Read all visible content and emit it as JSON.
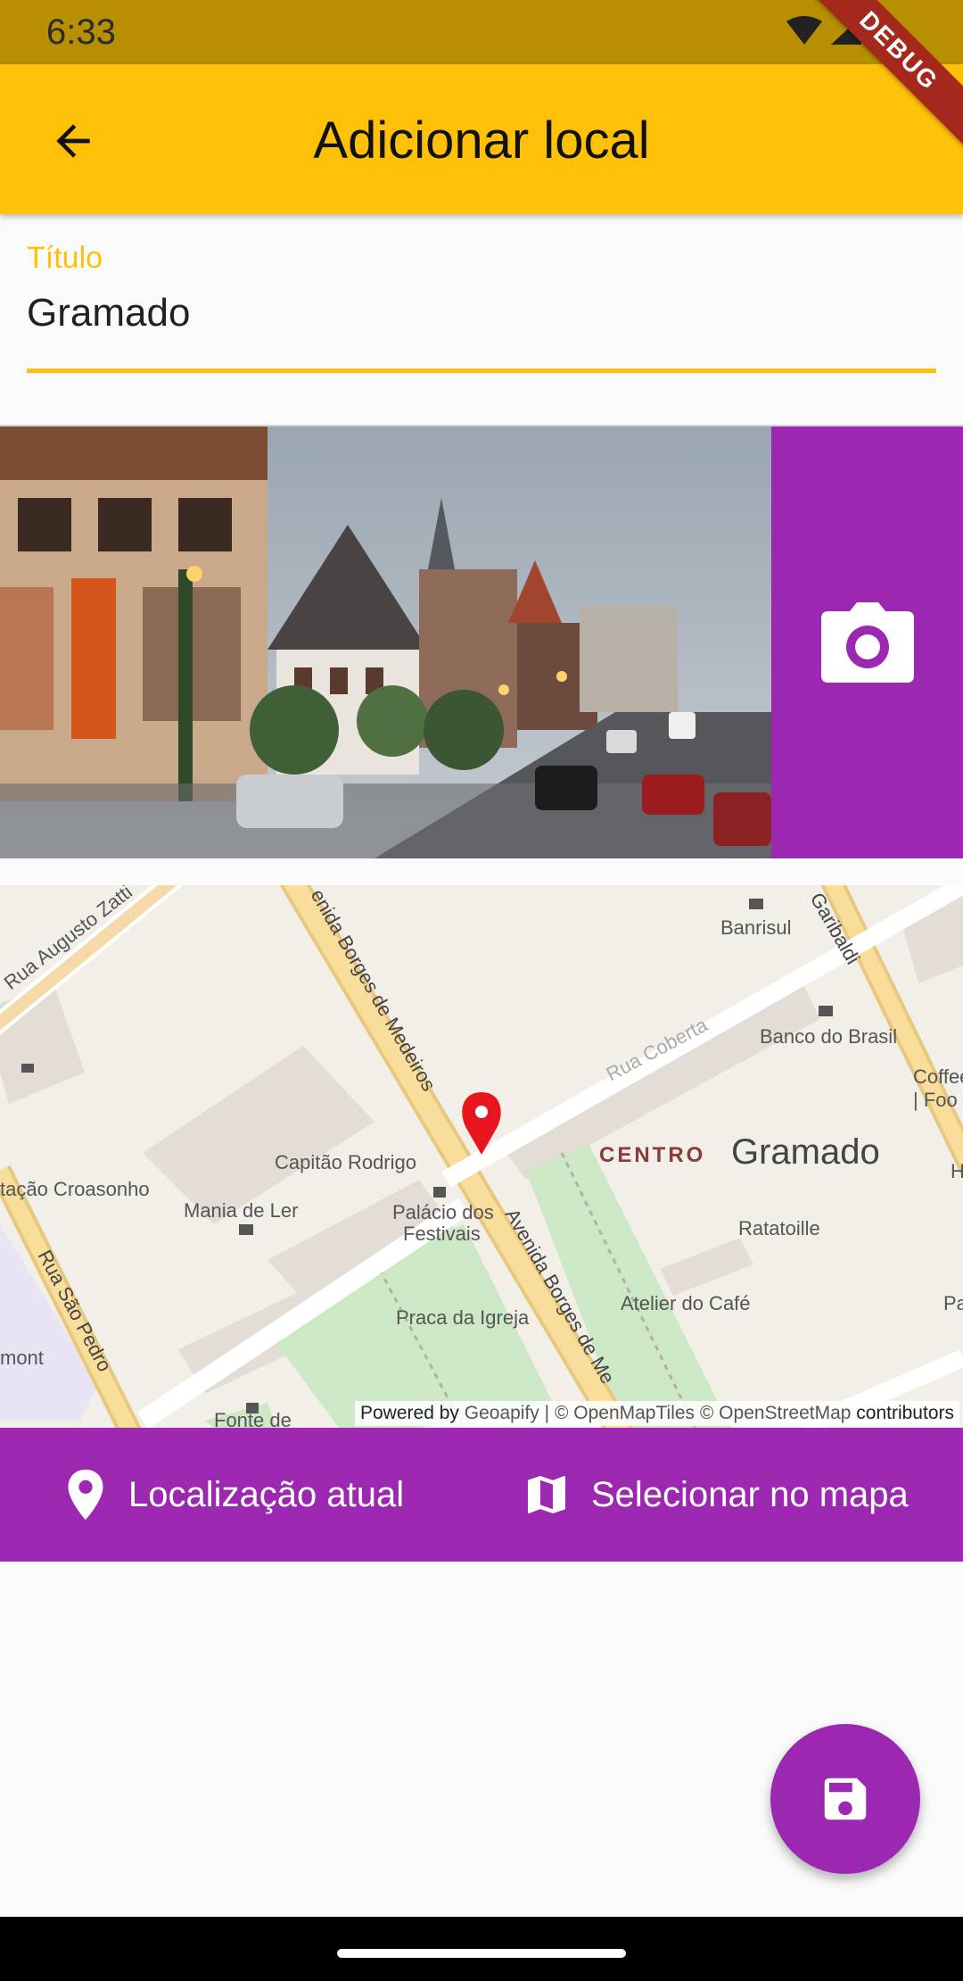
{
  "status_bar": {
    "time": "6:33"
  },
  "debug_banner": "DEBUG",
  "app_bar": {
    "title": "Adicionar local",
    "back_icon": "arrow-back-icon"
  },
  "form": {
    "title_label": "Título",
    "title_value": "Gramado"
  },
  "photo": {
    "camera_icon": "camera-icon"
  },
  "map": {
    "labels": {
      "rua_augusto_zatti": "Rua Augusto Zatti",
      "avenida_borges_1": "enida Borges de Medeiros",
      "garibaldi": "Garibaldi",
      "banrisul": "Banrisul",
      "banco_do_brasil": "Banco do Brasil",
      "rua_coberta": "Rua Coberta",
      "coffee": "Coffee",
      "coffee2": "| Foo",
      "centro": "CENTRO",
      "gramado": "Gramado",
      "capitao_rodrigo": "Capitão Rodrigo",
      "estacao": "tação Croasonho",
      "mania_de_ler": "Mania de Ler",
      "palacio_1": "Palácio dos",
      "palacio_2": "Festivais",
      "avenida_borges_2": "Avenida Borges de Me",
      "ratatoille": "Ratatoille",
      "atelier": "Atelier do Café",
      "praca": "Praca da Igreja",
      "rua_sao_pedro": "Rua São Pedro",
      "mont": "mont",
      "fonte": "Fonte de",
      "h_edge": "H",
      "pa_edge": "Pa"
    },
    "attribution": {
      "powered": "Powered by",
      "geoapify": "Geoapify",
      "rest": "| © OpenMapTiles © OpenStreetMap",
      "contributors": "contributors"
    }
  },
  "actions": {
    "current_location": {
      "label": "Localização atual",
      "icon": "location-pin-icon"
    },
    "select_on_map": {
      "label": "Selecionar no mapa",
      "icon": "map-icon"
    }
  },
  "fab": {
    "icon": "save-icon"
  },
  "colors": {
    "primary": "#FFC107",
    "accent": "#9C27B0",
    "status_bar": "#B88F00",
    "debug": "#A5281C",
    "marker": "#E8141E"
  }
}
